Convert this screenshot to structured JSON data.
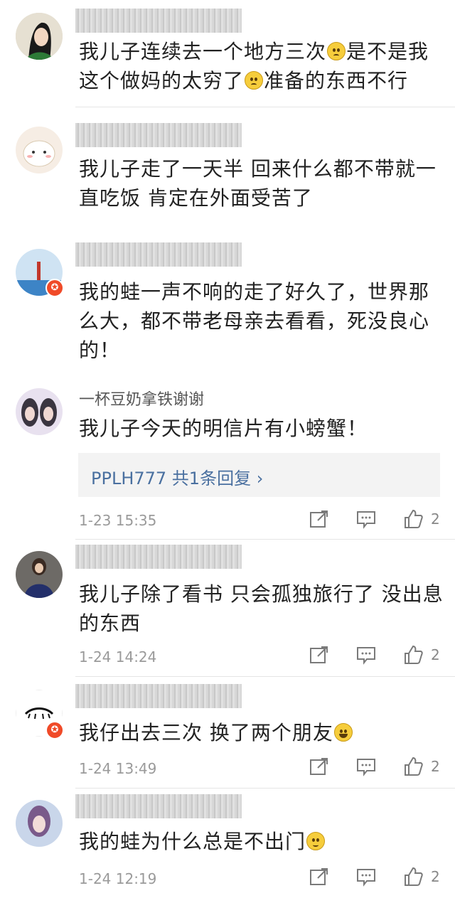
{
  "comments": [
    {
      "name_text": "",
      "text": "我儿子连续去一个地方三次",
      "text2": "是不是我这个做妈的太穷了",
      "text3": "准备的东西不行",
      "time": "",
      "likes": ""
    },
    {
      "name_text": "",
      "text": "我儿子走了一天半 回来什么都不带就一直吃饭 肯定在外面受苦了",
      "time": "",
      "likes": ""
    },
    {
      "name_text": "",
      "text": "我的蛙一声不响的走了好久了，世界那么大，都不带老母亲去看看，死没良心的！",
      "time": "",
      "likes": ""
    },
    {
      "name_text": "一杯豆奶拿铁谢谢",
      "text": "我儿子今天的明信片有小螃蟹！",
      "reply": "PPLH777  共1条回复 ›",
      "time": "1-23 15:35",
      "likes": "2"
    },
    {
      "name_text": "",
      "text": "我儿子除了看书 只会孤独旅行了 没出息的东西",
      "time": "1-24 14:24",
      "likes": "2"
    },
    {
      "name_text": "",
      "text": "我仔出去三次 换了两个朋友",
      "time": "1-24 13:49",
      "likes": "2"
    },
    {
      "name_text": "",
      "text": "我的蛙为什么总是不出门",
      "time": "1-24 12:19",
      "likes": "2"
    }
  ],
  "icons": {
    "share": "share-icon",
    "comment": "comment-icon",
    "like": "like-icon",
    "verified": "verified-badge-icon"
  },
  "colors": {
    "link": "#4a70a0",
    "badge": "#f04a28"
  }
}
